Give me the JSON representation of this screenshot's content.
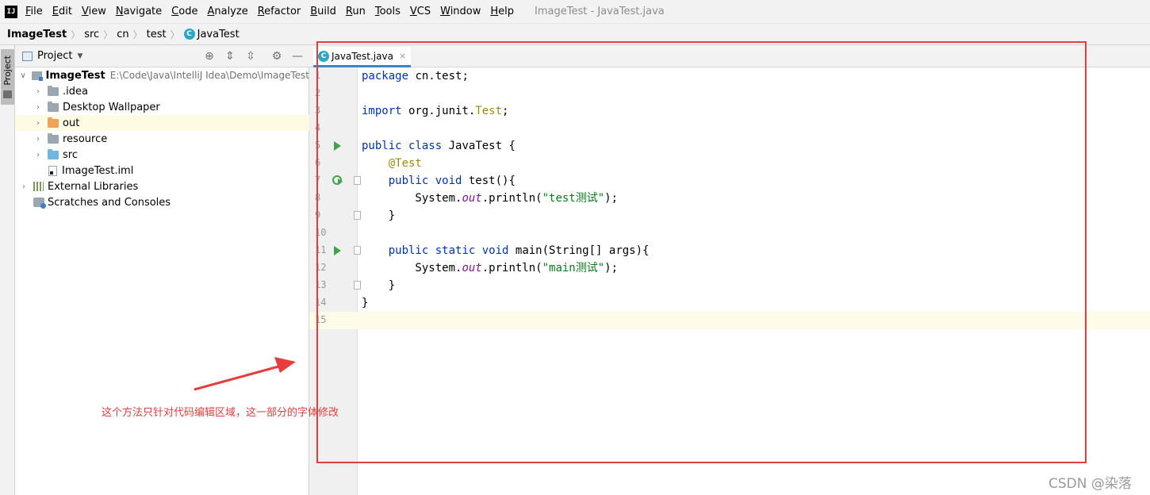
{
  "app": {
    "logo": "IJ",
    "window_title": "ImageTest - JavaTest.java"
  },
  "menu": {
    "items": [
      "File",
      "Edit",
      "View",
      "Navigate",
      "Code",
      "Analyze",
      "Refactor",
      "Build",
      "Run",
      "Tools",
      "VCS",
      "Window",
      "Help"
    ]
  },
  "breadcrumb": {
    "items": [
      "ImageTest",
      "src",
      "cn",
      "test",
      "JavaTest"
    ]
  },
  "tool_strip": {
    "project_label": "Project"
  },
  "project_panel": {
    "title": "Project",
    "tree": [
      {
        "label": "ImageTest",
        "path": "E:\\Code\\Java\\IntelliJ Idea\\Demo\\ImageTest",
        "icon": "module-folder-icon",
        "expanded": true,
        "depth": 0
      },
      {
        "label": ".idea",
        "icon": "folder-icon",
        "expanded": false,
        "depth": 1
      },
      {
        "label": "Desktop Wallpaper",
        "icon": "folder-icon",
        "expanded": false,
        "depth": 1
      },
      {
        "label": "out",
        "icon": "excluded-folder-icon",
        "expanded": false,
        "depth": 1
      },
      {
        "label": "resource",
        "icon": "folder-icon",
        "expanded": false,
        "depth": 1
      },
      {
        "label": "src",
        "icon": "source-folder-icon",
        "expanded": false,
        "depth": 1
      },
      {
        "label": "ImageTest.iml",
        "icon": "iml-file-icon",
        "depth": 1
      },
      {
        "label": "External Libraries",
        "icon": "library-icon",
        "expanded": false,
        "depth": 0
      },
      {
        "label": "Scratches and Consoles",
        "icon": "scratches-icon",
        "depth": 0
      }
    ]
  },
  "editor": {
    "tab": {
      "label": "JavaTest.java",
      "icon": "java-class-icon",
      "close": "×"
    },
    "java_icon_letter": "C",
    "lines": [
      {
        "num": "1",
        "text": "package cn.test;"
      },
      {
        "num": "2",
        "text": ""
      },
      {
        "num": "3",
        "text": "import org.junit.Test;"
      },
      {
        "num": "4",
        "text": ""
      },
      {
        "num": "5",
        "text": "public class JavaTest {",
        "gutter": "run"
      },
      {
        "num": "6",
        "text": "    @Test"
      },
      {
        "num": "7",
        "text": "    public void test(){",
        "gutter": "rerun",
        "fold": true
      },
      {
        "num": "8",
        "text": "        System.out.println(\"test测试\");"
      },
      {
        "num": "9",
        "text": "    }",
        "fold": true
      },
      {
        "num": "10",
        "text": ""
      },
      {
        "num": "11",
        "text": "    public static void main(String[] args){",
        "gutter": "run",
        "fold": true
      },
      {
        "num": "12",
        "text": "        System.out.println(\"main测试\");"
      },
      {
        "num": "13",
        "text": "    }",
        "fold": true
      },
      {
        "num": "14",
        "text": "}"
      },
      {
        "num": "15",
        "text": ""
      }
    ]
  },
  "annotation": {
    "note": "这个方法只针对代码编辑区域，这一部分的字体修改",
    "color": "#e83d3d"
  },
  "watermark": "CSDN @染落",
  "colors": {
    "keyword": "#0033b3",
    "annotation": "#9e880d",
    "string": "#067d17",
    "static_field": "#871094",
    "run_icon": "#3fa44a"
  }
}
